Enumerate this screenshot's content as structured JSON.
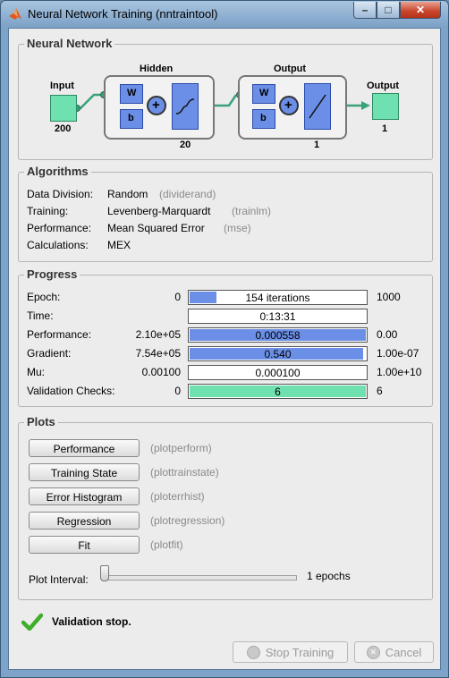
{
  "window": {
    "title": "Neural Network Training (nntraintool)"
  },
  "network": {
    "section_title": "Neural Network",
    "input_label": "Input",
    "input_size": "200",
    "hidden_label": "Hidden",
    "hidden_size": "20",
    "output_layer_label": "Output",
    "output_layer_size": "1",
    "output_label": "Output",
    "output_size": "1",
    "w_label": "W",
    "b_label": "b",
    "plus": "+"
  },
  "algorithms": {
    "section_title": "Algorithms",
    "rows": [
      {
        "key": "Data Division:",
        "value": "Random",
        "fn": "(dividerand)"
      },
      {
        "key": "Training:",
        "value": "Levenberg-Marquardt",
        "fn": "(trainlm)"
      },
      {
        "key": "Performance:",
        "value": "Mean Squared Error",
        "fn": "(mse)"
      },
      {
        "key": "Calculations:",
        "value": "MEX",
        "fn": ""
      }
    ]
  },
  "progress": {
    "section_title": "Progress",
    "rows": [
      {
        "key": "Epoch:",
        "start": "0",
        "value": "154 iterations",
        "end": "1000",
        "fill_fraction": 0.154,
        "fill_color": "#6b8fe6"
      },
      {
        "key": "Time:",
        "start": "",
        "value": "0:13:31",
        "end": "",
        "fill_fraction": 0,
        "fill_color": "#6b8fe6"
      },
      {
        "key": "Performance:",
        "start": "2.10e+05",
        "value": "0.000558",
        "end": "0.00",
        "fill_fraction": 1.0,
        "fill_color": "#6b8fe6"
      },
      {
        "key": "Gradient:",
        "start": "7.54e+05",
        "value": "0.540",
        "end": "1.00e-07",
        "fill_fraction": 0.985,
        "fill_color": "#6b8fe6"
      },
      {
        "key": "Mu:",
        "start": "0.00100",
        "value": "0.000100",
        "end": "1.00e+10",
        "fill_fraction": 0,
        "fill_color": "#6b8fe6"
      },
      {
        "key": "Validation Checks:",
        "start": "0",
        "value": "6",
        "end": "6",
        "fill_fraction": 1.0,
        "fill_color": "#6fe0b0"
      }
    ]
  },
  "plots": {
    "section_title": "Plots",
    "buttons": [
      {
        "label": "Performance",
        "fn": "(plotperform)"
      },
      {
        "label": "Training State",
        "fn": "(plottrainstate)"
      },
      {
        "label": "Error Histogram",
        "fn": "(ploterrhist)"
      },
      {
        "label": "Regression",
        "fn": "(plotregression)"
      },
      {
        "label": "Fit",
        "fn": "(plotfit)"
      }
    ],
    "interval_label": "Plot Interval:",
    "interval_value": "1 epochs"
  },
  "status": {
    "text": "Validation stop."
  },
  "actions": {
    "stop_label": "Stop Training",
    "cancel_label": "Cancel"
  },
  "colors": {
    "blue": "#6b8fe6",
    "green": "#6fe0b0",
    "check": "#3fae2b"
  }
}
